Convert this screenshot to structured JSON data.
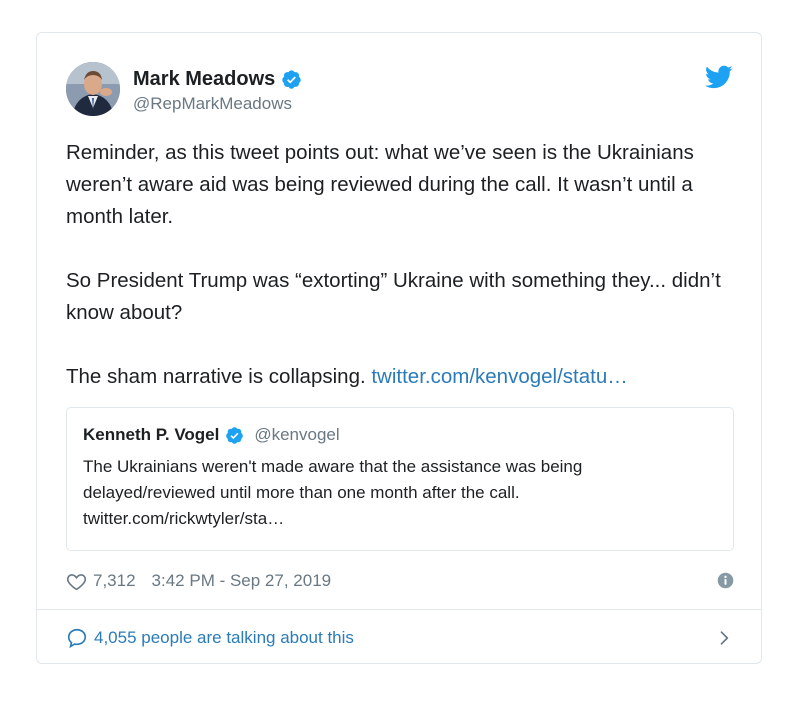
{
  "author": {
    "name": "Mark Meadows",
    "handle": "@RepMarkMeadows",
    "verified": true
  },
  "tweet": {
    "paragraph_1": "Reminder, as this tweet points out: what we’ve seen is the Ukrainians weren’t aware aid was being reviewed during the call. It wasn’t until a month later.",
    "paragraph_2": "So President Trump was “extorting” Ukraine with something they... didn’t know about?",
    "paragraph_3_text": "The sham narrative is collapsing. ",
    "paragraph_3_link": "twitter.com/kenvogel/statu…"
  },
  "quoted_tweet": {
    "name": "Kenneth P. Vogel",
    "handle": "@kenvogel",
    "verified": true,
    "text": "The Ukrainians weren't made aware that the assistance was being delayed/reviewed until more than one month after the call. twitter.com/rickwtyler/sta…"
  },
  "meta": {
    "likes": "7,312",
    "timestamp": "3:42 PM - Sep 27, 2019"
  },
  "conversation": {
    "label": "4,055 people are talking about this"
  },
  "icons": {
    "verified": "verified-badge-icon",
    "brand": "twitter-bird-icon",
    "like": "heart-icon",
    "info": "info-icon",
    "reply": "speech-bubble-icon",
    "more": "chevron-right-icon"
  },
  "colors": {
    "twitter_blue": "#1da1f2",
    "link": "#2b7bb9",
    "text": "#1c2022",
    "secondary": "#697882",
    "border": "#e1e8ed"
  }
}
